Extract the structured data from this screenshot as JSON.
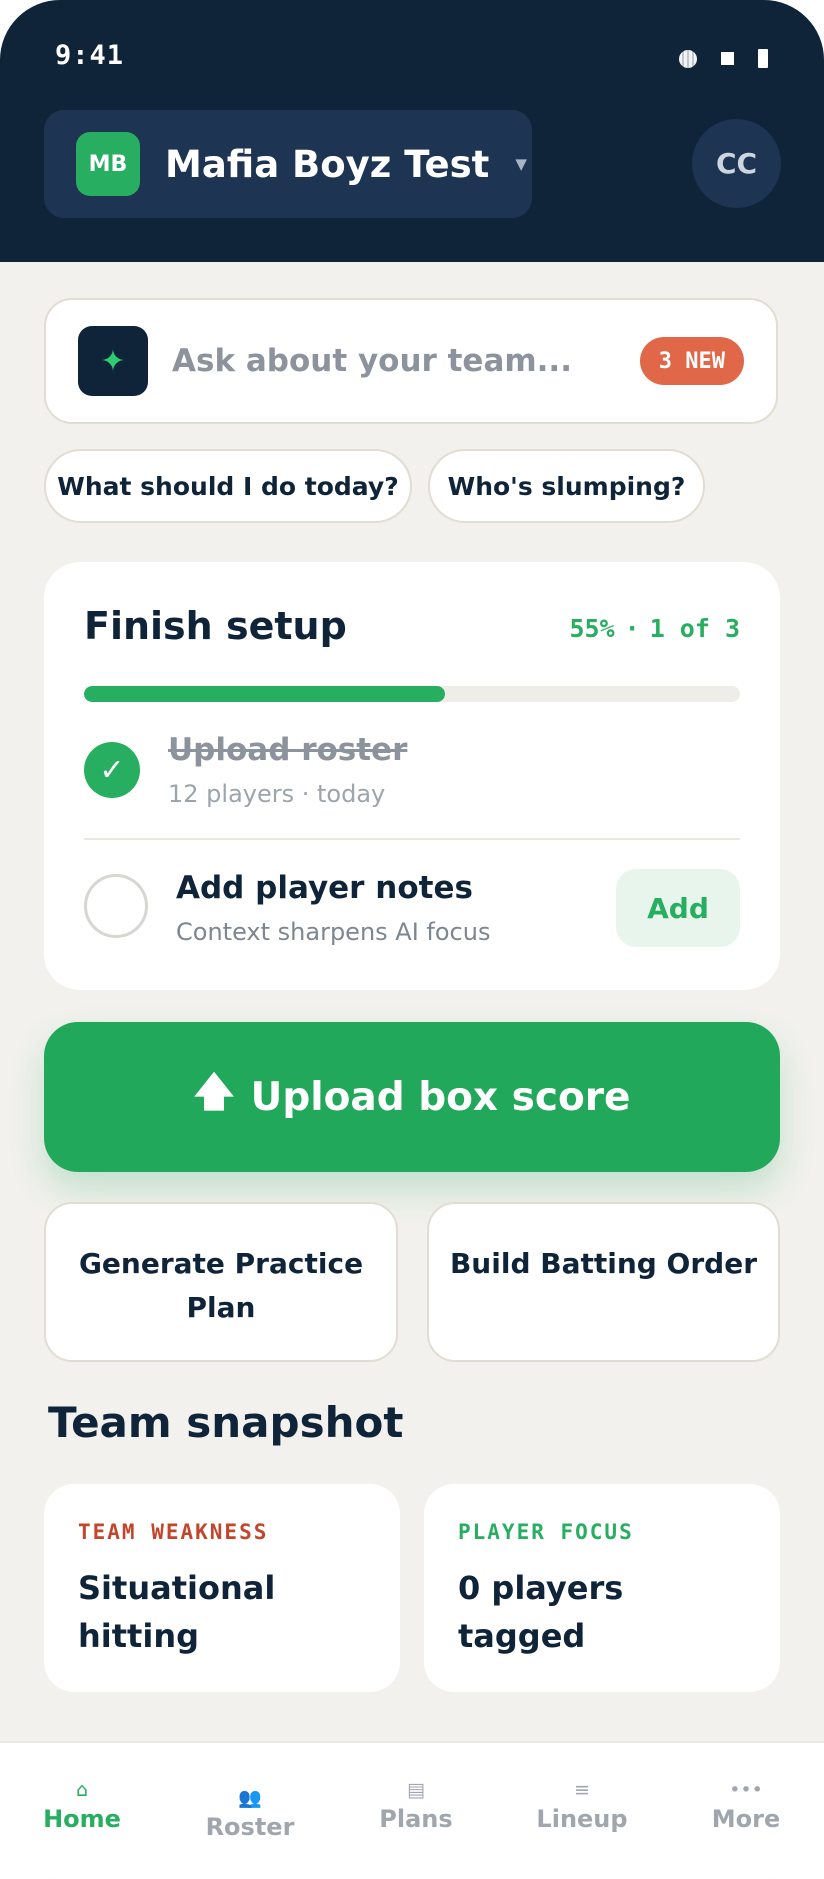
{
  "status_bar": {
    "time": "9:41"
  },
  "header": {
    "team_initials": "MB",
    "team_name": "Mafia Boyz Test",
    "user_initials": "CC"
  },
  "ask": {
    "placeholder": "Ask about your team...",
    "badge": "3 NEW"
  },
  "chips": [
    "What should I do today?",
    "Who's slumping?"
  ],
  "setup": {
    "title": "Finish setup",
    "percent_text": "55%",
    "separator": "·",
    "steps_text": "1 of 3",
    "progress": 0.55,
    "tasks": [
      {
        "title": "Upload roster",
        "subtitle": "12 players · today",
        "done": true
      },
      {
        "title": "Add player notes",
        "subtitle": "Context sharpens AI focus",
        "done": false,
        "action": "Add"
      }
    ]
  },
  "upload": {
    "label": "Upload box score"
  },
  "actions": [
    "Generate Practice Plan",
    "Build Batting Order"
  ],
  "snapshot": {
    "title": "Team snapshot",
    "cards": [
      {
        "label": "TEAM WEAKNESS",
        "value": "Situational hitting"
      },
      {
        "label": "PLAYER FOCUS",
        "value": "0 players tagged"
      }
    ]
  },
  "nav": {
    "items": [
      {
        "label": "Home",
        "icon": "home-icon",
        "active": true
      },
      {
        "label": "Roster",
        "icon": "roster-icon",
        "active": false
      },
      {
        "label": "Plans",
        "icon": "plans-icon",
        "active": false
      },
      {
        "label": "Lineup",
        "icon": "lineup-icon",
        "active": false
      },
      {
        "label": "More",
        "icon": "more-icon",
        "active": false
      }
    ]
  },
  "colors": {
    "navy": "#0f2339",
    "green": "#27ae60",
    "orange": "#e06848",
    "background": "#f2f1ed"
  }
}
